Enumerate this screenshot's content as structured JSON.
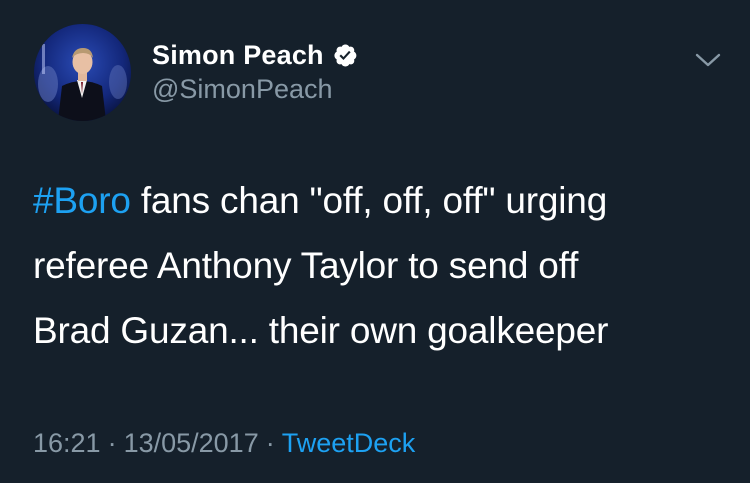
{
  "author": {
    "display_name": "Simon Peach",
    "handle": "@SimonPeach",
    "verified": true,
    "avatar_icon": "person-portrait-avatar"
  },
  "menu": {
    "icon": "chevron-down-icon"
  },
  "tweet": {
    "hashtag": "#Boro",
    "text_line1_rest": " fans chan \"off, off, off\" urging",
    "text_line2": "referee Anthony Taylor to send off",
    "text_line3": "Brad Guzan... their own goalkeeper"
  },
  "meta": {
    "time": "16:21",
    "separator1": "·",
    "date": "13/05/2017",
    "separator2": "·",
    "source": "TweetDeck"
  },
  "colors": {
    "background": "#15202b",
    "primary_text": "#ffffff",
    "secondary_text": "#8899a6",
    "accent": "#1da1f2"
  }
}
